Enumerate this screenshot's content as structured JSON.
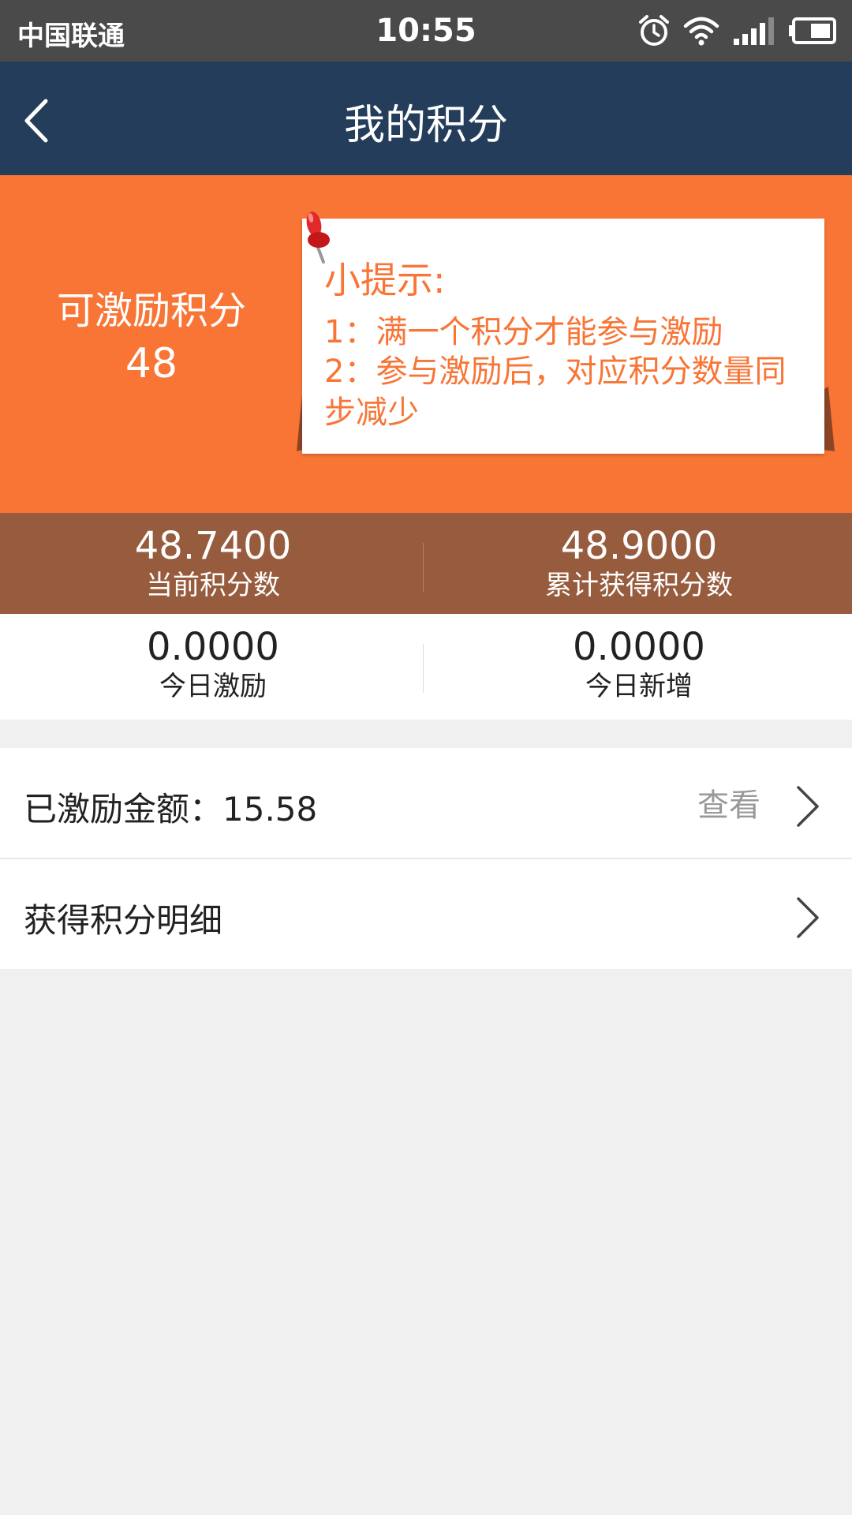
{
  "status_bar": {
    "carrier": "中国联通",
    "time": "10:55",
    "icons": [
      "alarm-icon",
      "wifi-icon",
      "signal-icon",
      "battery-icon"
    ]
  },
  "nav": {
    "title": "我的积分",
    "back_icon": "back-arrow-icon"
  },
  "points_card": {
    "available_label": "可激励积分",
    "available_value": "48",
    "tip": {
      "title": "小提示:",
      "line1": "1：满一个积分才能参与激励",
      "line2": "2：参与激励后，对应积分数量同步减少"
    }
  },
  "stats": {
    "current_points": {
      "value": "48.7400",
      "label": "当前积分数"
    },
    "total_earned": {
      "value": "48.9000",
      "label": "累计获得积分数"
    },
    "today_incentive": {
      "value": "0.0000",
      "label": "今日激励"
    },
    "today_added": {
      "value": "0.0000",
      "label": "今日新增"
    }
  },
  "list": {
    "incentive_amount": {
      "label": "已激励金额：15.58",
      "action": "查看"
    },
    "points_detail": {
      "label": "获得积分明细"
    }
  },
  "colors": {
    "status_bar": "#4a4a4a",
    "nav_bar": "#233d5b",
    "orange": "#f87536",
    "brown": "#975c3e",
    "background": "#f0f0f0"
  }
}
